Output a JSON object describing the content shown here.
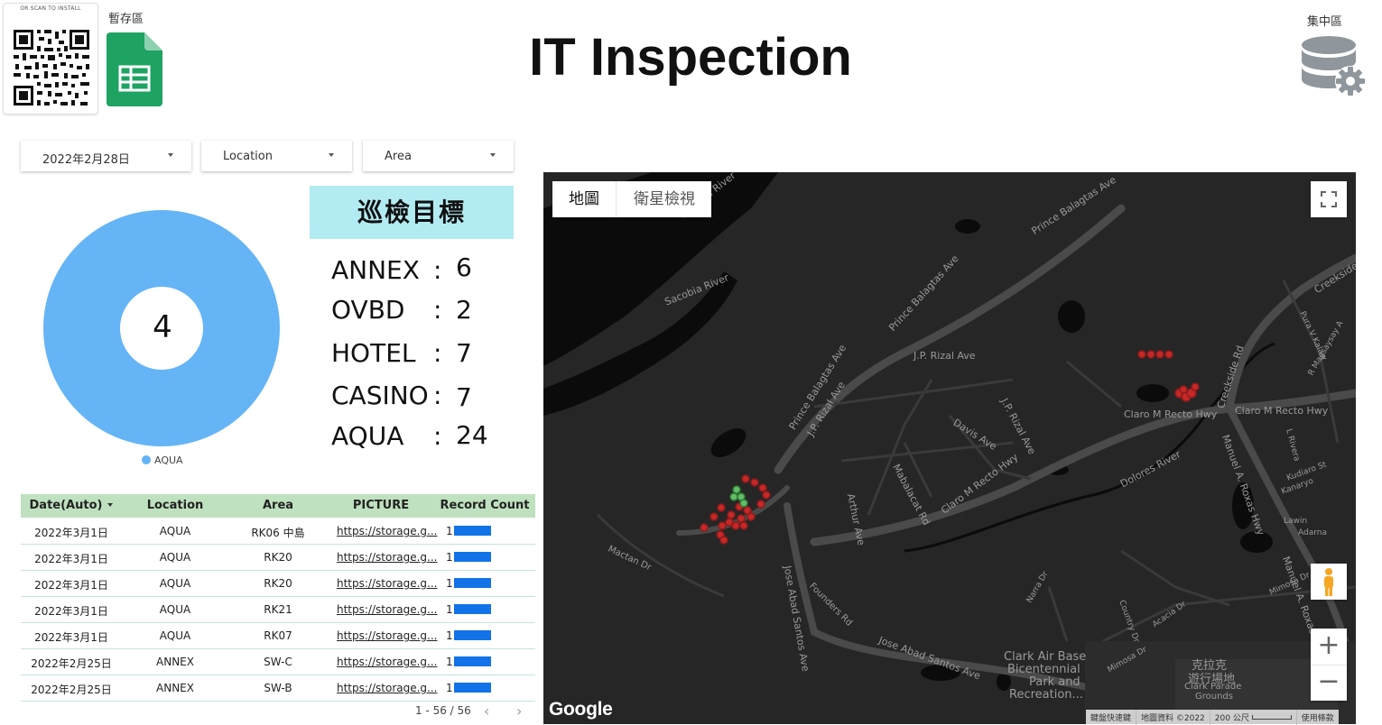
{
  "header": {
    "qr_caption": "OR SCAN TO INSTALL",
    "temp_label": "暫存區",
    "title": "IT Inspection",
    "hub_label": "集中區"
  },
  "filters": {
    "date": "2022年2月28日",
    "location": "Location",
    "area": "Area"
  },
  "donut": {
    "value": "4",
    "legend": "AQUA",
    "color": "#64b4f6"
  },
  "targets": {
    "title": "巡檢目標",
    "items": [
      {
        "name": "ANNEX",
        "colon": ":",
        "value": "6"
      },
      {
        "name": "OVBD",
        "colon": ":",
        "value": "2"
      },
      {
        "name": "HOTEL",
        "colon": ":",
        "value": "7"
      },
      {
        "name": "CASINO",
        "colon": ":",
        "value": "7"
      },
      {
        "name": "AQUA",
        "colon": ":",
        "value": "24"
      }
    ]
  },
  "table": {
    "headers": [
      "Date(Auto)",
      "Location",
      "Area",
      "PICTURE",
      "Record Count"
    ],
    "rows": [
      {
        "date": "2022年3月1日",
        "location": "AQUA",
        "area": "RK06 中島",
        "picture": "https://storage.g...",
        "count": "1"
      },
      {
        "date": "2022年3月1日",
        "location": "AQUA",
        "area": "RK20",
        "picture": "https://storage.g...",
        "count": "1"
      },
      {
        "date": "2022年3月1日",
        "location": "AQUA",
        "area": "RK20",
        "picture": "https://storage.g...",
        "count": "1"
      },
      {
        "date": "2022年3月1日",
        "location": "AQUA",
        "area": "RK21",
        "picture": "https://storage.g...",
        "count": "1"
      },
      {
        "date": "2022年3月1日",
        "location": "AQUA",
        "area": "RK07",
        "picture": "https://storage.g...",
        "count": "1"
      },
      {
        "date": "2022年2月25日",
        "location": "ANNEX",
        "area": "SW-C",
        "picture": "https://storage.g...",
        "count": "1"
      },
      {
        "date": "2022年2月25日",
        "location": "ANNEX",
        "area": "SW-B",
        "picture": "https://storage.g...",
        "count": "1"
      }
    ],
    "pagination": "1 - 56 / 56",
    "prev": "‹",
    "next": "›",
    "bar_color": "#1273e8"
  },
  "map": {
    "tab_map": "地圖",
    "tab_satellite": "衛星檢視",
    "zoom_in": "+",
    "zoom_out": "−",
    "google": "Google",
    "attribution": {
      "shortcuts": "鍵盤快速鍵",
      "data": "地圖資料 ©2022",
      "scale": "200 公尺",
      "terms": "使用條款"
    },
    "labels": {
      "sacobia1": "Sacobia River",
      "sacobia2": "Sacobia River",
      "prince1": "Prince Balagtas Ave",
      "prince2": "Prince Balagtas Ave",
      "prince3": "Prince Balagtas Ave",
      "jprizal1": "J.P. Rizal Ave",
      "jprizal2": "J.P. Rizal Ave",
      "jprizal3": "J.P. Rizal Ave",
      "davis": "Davis Ave",
      "mabalacat": "Mabalacat Rd",
      "arthur": "Arthur Ave",
      "claro1": "Claro M Recto Hwy",
      "claro2": "Claro M Recto Hwy",
      "claro3": "Claro M Recto Hwy",
      "dolores": "Dolores River",
      "creekside1": "Creekside Rd",
      "creekside2": "Creekside",
      "manuel1": "Manuel A. Roxas Hwy",
      "manuel2": "Manuel A. Roxas Hw",
      "pura": "Pura V Kalaw",
      "rmagsaysay": "R Magsaysay A",
      "lrivera": "L Rivera",
      "kudiaro": "Kudiaro St",
      "kanaryo": "Kanaryo",
      "lawin": "Lawin",
      "adarna": "Adarna",
      "mimosa1": "Mimosa Dr",
      "mimosa2": "Mimosa Dr",
      "joseabad1": "Jose Abad Santos Ave",
      "joseabad2": "Jose Abad Santos Ave",
      "mactan": "Mactan Dr",
      "founders": "Founders Rd",
      "narra": "Narra Dr",
      "country": "Country Dr",
      "acacia": "Acacia Dr",
      "clark_air": "Clark Air Base",
      "bicentennial": "Bicentennial",
      "park_and": "Park and",
      "recreation": "Recreation...",
      "parade_zh1": "克拉克",
      "parade_zh2": "遊行場地",
      "parade_en1": "Clark Parade",
      "parade_en2": "Grounds"
    }
  }
}
